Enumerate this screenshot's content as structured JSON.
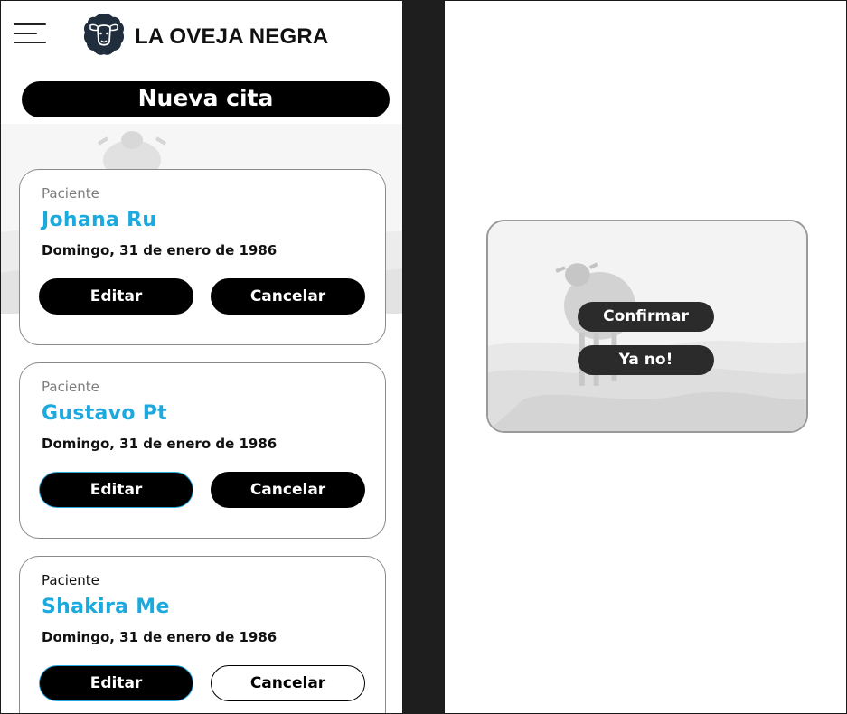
{
  "header": {
    "brand": "LA OVEJA NEGRA",
    "menu_icon": "hamburger-menu-icon",
    "logo_icon": "black-sheep-logo-icon"
  },
  "new_appointment_button": "Nueva cita",
  "appointments": [
    {
      "label": "Paciente",
      "name": "Johana Ru",
      "date": "Domingo, 31 de enero de 1986",
      "edit": "Editar",
      "cancel": "Cancelar"
    },
    {
      "label": "Paciente",
      "name": "Gustavo Pt",
      "date": "Domingo, 31 de enero de 1986",
      "edit": "Editar",
      "cancel": "Cancelar"
    },
    {
      "label": "Paciente",
      "name": "Shakira Me",
      "date": "Domingo, 31 de enero de 1986",
      "edit": "Editar",
      "cancel": "Cancelar"
    }
  ],
  "confirm_dialog": {
    "confirm_button": "Confirmar",
    "decline_button": "Ya no!"
  },
  "colors": {
    "accent": "#1ba9de",
    "primary": "#000000",
    "divider": "#1e1e1e"
  }
}
